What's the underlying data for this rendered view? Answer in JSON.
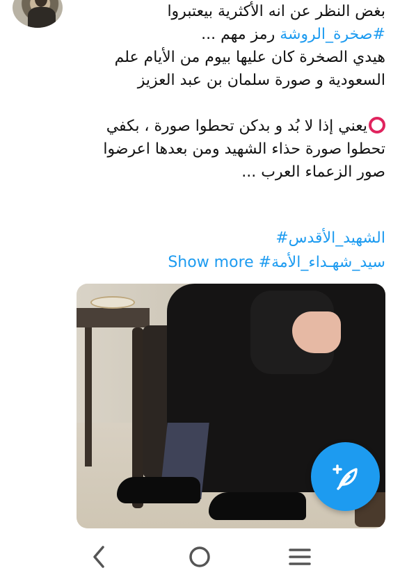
{
  "tweet": {
    "lines": [
      "بغض النظر عن انه الأكثرية بيعتبروا",
      "هيدي الصخرة كان عليها بيوم من الأيام علم",
      "السعودية و صورة سلمان بن عبد العزيز",
      "يعني إذا لا بُد و بدكن تحطوا صورة ، بكفي",
      "تحطوا صورة حذاء الشهيد ومن بعدها اعرضوا",
      "صور الزعماء العرب ..."
    ],
    "hashtag_inline": "#صخرة_الروشة",
    "hashtag_inline_suffix": " رمز مهم ...",
    "hashtags": [
      "الشهيد_الأقدس#",
      "سيد_شهـداء_الأمة#"
    ],
    "show_more": "Show more"
  },
  "colors": {
    "link": "#1d9bf0",
    "emoji_ring": "#e0245e",
    "fab": "#1d9bf0"
  },
  "icons": {
    "fab": "compose-feather-icon",
    "nav_back": "chevron-left-icon",
    "nav_home": "circle-home-icon",
    "nav_recents": "menu-lines-icon"
  }
}
